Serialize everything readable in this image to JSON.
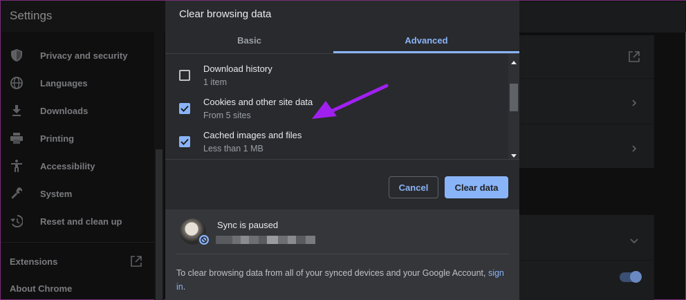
{
  "settings": {
    "title": "Settings",
    "sidebar": [
      {
        "label": "Privacy and security",
        "icon": "shield-icon"
      },
      {
        "label": "Languages",
        "icon": "globe-icon"
      },
      {
        "label": "Downloads",
        "icon": "download-icon"
      },
      {
        "label": "Printing",
        "icon": "printer-icon"
      },
      {
        "label": "Accessibility",
        "icon": "accessibility-icon"
      },
      {
        "label": "System",
        "icon": "wrench-icon"
      },
      {
        "label": "Reset and clean up",
        "icon": "restore-icon"
      }
    ],
    "extensions_label": "Extensions",
    "about_label": "About Chrome"
  },
  "dialog": {
    "title": "Clear browsing data",
    "tabs": {
      "basic": "Basic",
      "advanced": "Advanced",
      "active": "advanced"
    },
    "items": [
      {
        "name": "Download history",
        "detail": "1 item",
        "checked": false
      },
      {
        "name": "Cookies and other site data",
        "detail": "From 5 sites",
        "checked": true
      },
      {
        "name": "Cached images and files",
        "detail": "Less than 1 MB",
        "checked": true
      }
    ],
    "cancel_label": "Cancel",
    "clear_label": "Clear data",
    "sync": {
      "status": "Sync is paused",
      "note_text": "To clear browsing data from all of your synced devices and your Google Account,",
      "link_text": "sign in",
      "note_end": "."
    }
  },
  "colors": {
    "accent": "#8ab4f8",
    "dialog_bg": "#292a2d",
    "sync_bg": "#35363a",
    "arrow": "#a020f0"
  }
}
